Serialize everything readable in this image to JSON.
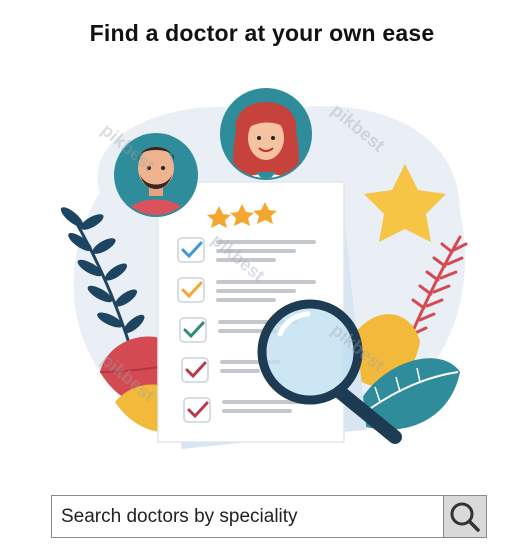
{
  "header": {
    "title": "Find a doctor at your own ease"
  },
  "hero_image": {
    "watermark_text": "pikbest",
    "colors": {
      "blob": "#e8eef3",
      "teal": "#2f8c9a",
      "navy": "#1d4460",
      "star": "#f7c546",
      "red": "#d44a52",
      "paper": "#ffffff",
      "accent_blue": "#4aa8d8"
    }
  },
  "search": {
    "placeholder": "Search doctors by speciality",
    "value": "",
    "button_icon": "search-icon"
  }
}
